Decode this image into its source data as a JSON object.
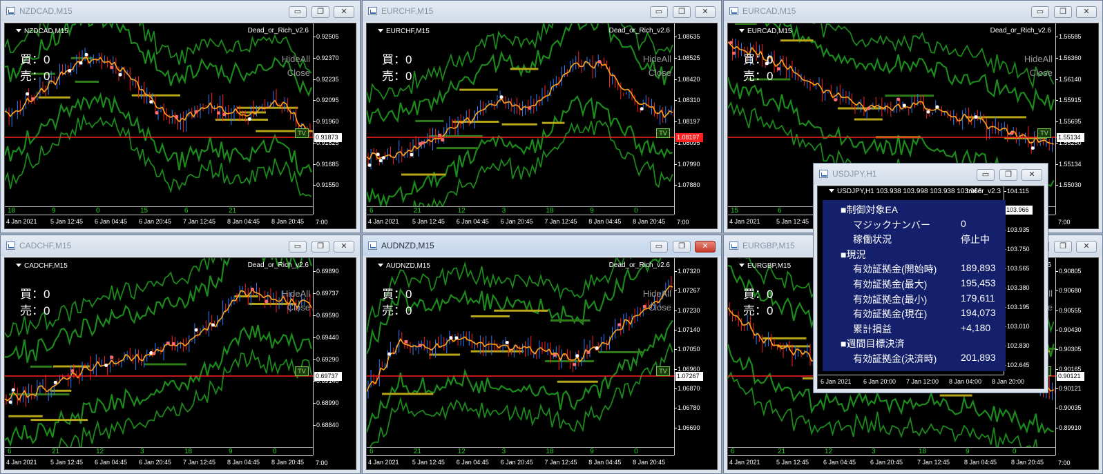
{
  "colors": {
    "bull": "#2f7cff",
    "bear": "#ff1e1e",
    "ma": "#ffa21a",
    "band": "#1c8a1c",
    "level": "#b7a617",
    "greenzone": "#2e7d18",
    "text": "#ffffff",
    "panel": "#14206b"
  },
  "ea_label": "Dead_or_Rich_v2.6",
  "buy_label": "買：0",
  "sell_label": "売：0",
  "hideall": "HideAll",
  "close": "Close",
  "tv": "TV",
  "windows": [
    {
      "title": "NZDCAD,M15",
      "symbol": "NZDCAD,M15",
      "prices": [
        "0.92505",
        "0.92370",
        "0.92235",
        "0.92095",
        "0.91960",
        "0.91825",
        "0.91685",
        "0.91550"
      ],
      "current": "0.91873",
      "current_color": "white",
      "sub_numbers": [
        "18",
        "9",
        "0",
        "15",
        "6",
        "21"
      ],
      "time_labels": [
        "4 Jan 2021",
        "5 Jan 12:45",
        "6 Jan 04:45",
        "6 Jan 20:45",
        "7 Jan 12:45",
        "8 Jan 04:45",
        "8 Jan 20:45"
      ],
      "corner": "7:00"
    },
    {
      "title": "EURCHF,M15",
      "symbol": "EURCHF,M15",
      "prices": [
        "1.08635",
        "1.08525",
        "1.08420",
        "1.08310",
        "1.08197",
        "1.08095",
        "1.07990",
        "1.07880"
      ],
      "current": "1.08197",
      "current_color": "red",
      "sub_numbers": [
        "6",
        "21",
        "12",
        "3",
        "18",
        "9",
        "0"
      ],
      "time_labels": [
        "4 Jan 2021",
        "5 Jan 12:45",
        "6 Jan 04:45",
        "6 Jan 20:45",
        "7 Jan 12:45",
        "8 Jan 04:45",
        "8 Jan 20:45"
      ],
      "corner": "7:00"
    },
    {
      "title": "EURCAD,M15",
      "symbol": "EURCAD,M15",
      "prices": [
        "1.56585",
        "1.56360",
        "1.56140",
        "1.55915",
        "1.55695",
        "1.55250",
        "1.55134",
        "1.55030"
      ],
      "current": "1.55134",
      "current_color": "white",
      "sub_numbers": [
        "15",
        "6"
      ],
      "time_labels": [
        "4 Jan 2021",
        "5 Jan 12:45"
      ],
      "corner": "7:00"
    },
    {
      "title": "CADCHF,M15",
      "symbol": "CADCHF,M15",
      "prices": [
        "0.69890",
        "0.69737",
        "0.69590",
        "0.69440",
        "0.69290",
        "0.69140",
        "0.68990",
        "0.68840"
      ],
      "current": "0.69737",
      "current_color": "white",
      "sub_numbers": [
        "6",
        "21",
        "12",
        "3",
        "18",
        "9",
        "0"
      ],
      "time_labels": [
        "4 Jan 2021",
        "5 Jan 12:45",
        "6 Jan 04:45",
        "6 Jan 20:45",
        "7 Jan 12:45",
        "8 Jan 04:45",
        "8 Jan 20:45"
      ],
      "corner": "7:00"
    },
    {
      "title": "AUDNZD,M15",
      "symbol": "AUDNZD,M15",
      "prices": [
        "1.07320",
        "1.07267",
        "1.07230",
        "1.07140",
        "1.07050",
        "1.06960",
        "1.06870",
        "1.06780",
        "1.06690"
      ],
      "current": "1.07267",
      "current_color": "white",
      "sub_numbers": [
        "6",
        "21",
        "12",
        "3",
        "18",
        "9",
        "0"
      ],
      "time_labels": [
        "4 Jan 2021",
        "5 Jan 12:45",
        "6 Jan 04:45",
        "6 Jan 20:45",
        "7 Jan 12:45",
        "8 Jan 04:45",
        "8 Jan 20:45"
      ],
      "corner": ""
    },
    {
      "title": "EURGBP,M15",
      "symbol": "EURGBP,M15",
      "prices": [
        "0.90805",
        "0.90680",
        "0.90555",
        "0.90430",
        "0.90305",
        "0.90165",
        "0.90121",
        "0.90035",
        "0.89910"
      ],
      "current": "0.90121",
      "current_color": "white",
      "sub_numbers": [
        "6",
        "21",
        "12",
        "3",
        "18",
        "9",
        "0"
      ],
      "time_labels": [
        "4 Jan 2021",
        "5 Jan 12:45",
        "6 Jan 04:45",
        "6 Jan 20:45",
        "7 Jan 12:45",
        "8 Jan 04:45",
        "8 Jan 20:45"
      ],
      "corner": "7:00"
    }
  ],
  "usdjpy": {
    "title": "USDJPY,H1",
    "header": "USDJPY,H1  103.938 103.998 103.938 103.966",
    "header_right": "troller_v2.3",
    "prices": [
      "104.115",
      "103.966",
      "103.935",
      "103.750",
      "103.565",
      "103.380",
      "103.195",
      "103.010",
      "102.830",
      "102.645"
    ],
    "current": "103.966",
    "time_labels": [
      "6 Jan 2021",
      "6 Jan 20:00",
      "7 Jan 12:00",
      "8 Jan 04:00",
      "8 Jan 20:00"
    ],
    "panel": [
      {
        "label": "■制御対象EA",
        "value": "",
        "indent": false
      },
      {
        "label": "マジックナンバー",
        "value": "0",
        "indent": true
      },
      {
        "label": "稼働状況",
        "value": "停止中",
        "indent": true
      },
      {
        "label": "■現況",
        "value": "",
        "indent": false
      },
      {
        "label": "有効証拠金(開始時)",
        "value": "189,893",
        "indent": true
      },
      {
        "label": "有効証拠金(最大)",
        "value": "195,453",
        "indent": true
      },
      {
        "label": "有効証拠金(最小)",
        "value": "179,611",
        "indent": true
      },
      {
        "label": "有効証拠金(現在)",
        "value": "194,073",
        "indent": true
      },
      {
        "label": "累計損益",
        "value": "+4,180",
        "indent": true
      },
      {
        "label": "■週間目標決済",
        "value": "",
        "indent": false
      },
      {
        "label": "有効証拠金(決済時)",
        "value": "201,893",
        "indent": true
      }
    ]
  }
}
